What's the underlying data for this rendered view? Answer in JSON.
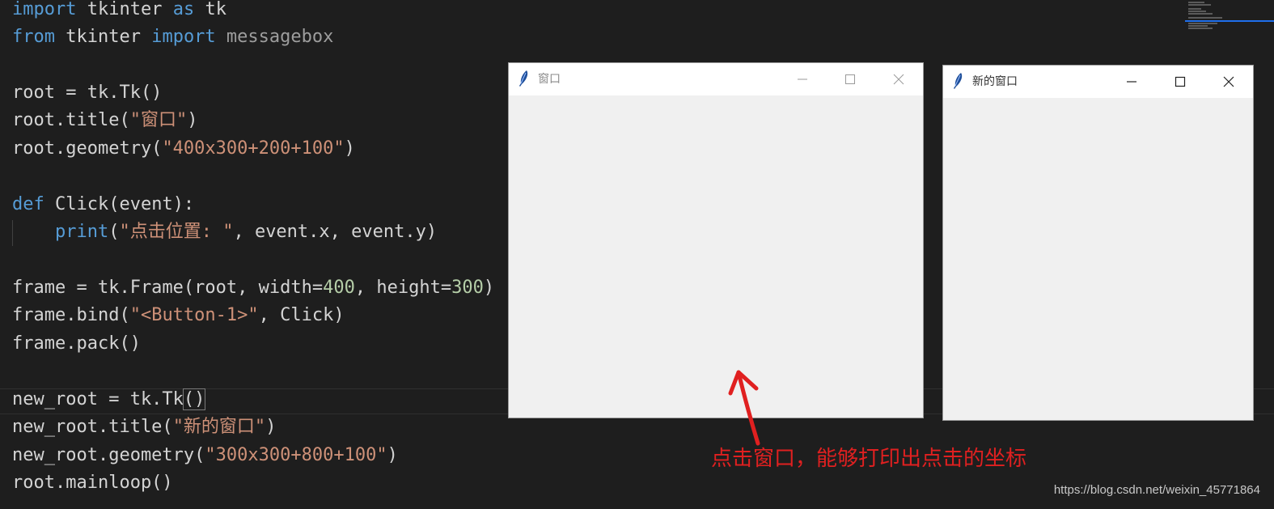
{
  "editor": {
    "lines": {
      "l1": {
        "kw_import": "import",
        "mod": " tkinter ",
        "kw_as": "as",
        "alias": " tk"
      },
      "l2": {
        "kw_from": "from",
        "mod": " tkinter ",
        "kw_import": "import",
        "name": " messagebox"
      },
      "l4": {
        "text": "root = tk.Tk()"
      },
      "l5": {
        "pre": "root.title(",
        "str": "\"窗口\"",
        "post": ")"
      },
      "l6": {
        "pre": "root.geometry(",
        "str": "\"400x300+200+100\"",
        "post": ")"
      },
      "l8": {
        "kw_def": "def",
        "rest": " Click(event):"
      },
      "l9": {
        "indent": "    ",
        "fn": "print",
        "open": "(",
        "str": "\"点击位置: \"",
        "rest": ", event.x, event.y)"
      },
      "l11": {
        "pre": "frame = tk.Frame(root, width=",
        "num1": "400",
        "mid": ", height=",
        "num2": "300",
        "post": ")"
      },
      "l12": {
        "pre": "frame.bind(",
        "str": "\"<Button-1>\"",
        "post": ", Click)"
      },
      "l13": {
        "text": "frame.pack()"
      },
      "l15": {
        "pre": "new_root = tk.Tk",
        "paren": "()"
      },
      "l16": {
        "pre": "new_root.title(",
        "str": "\"新的窗口\"",
        "post": ")"
      },
      "l17": {
        "pre": "new_root.geometry(",
        "str": "\"300x300+800+100\"",
        "post": ")"
      },
      "l18": {
        "text": "root.mainloop()"
      }
    }
  },
  "windows": {
    "root": {
      "title": "窗口",
      "active": false
    },
    "new_root": {
      "title": "新的窗口",
      "active": true
    }
  },
  "annotation": {
    "text": "点击窗口，能够打印出点击的坐标",
    "color": "#e02020"
  },
  "watermark": {
    "text": "https://blog.csdn.net/weixin_45771864"
  },
  "colors": {
    "editor_bg": "#1e1e1e",
    "keyword": "#569cd6",
    "string": "#ce9178",
    "number": "#b5cea8",
    "function": "#dcdcaa",
    "tk_bg": "#f0f0f0"
  }
}
